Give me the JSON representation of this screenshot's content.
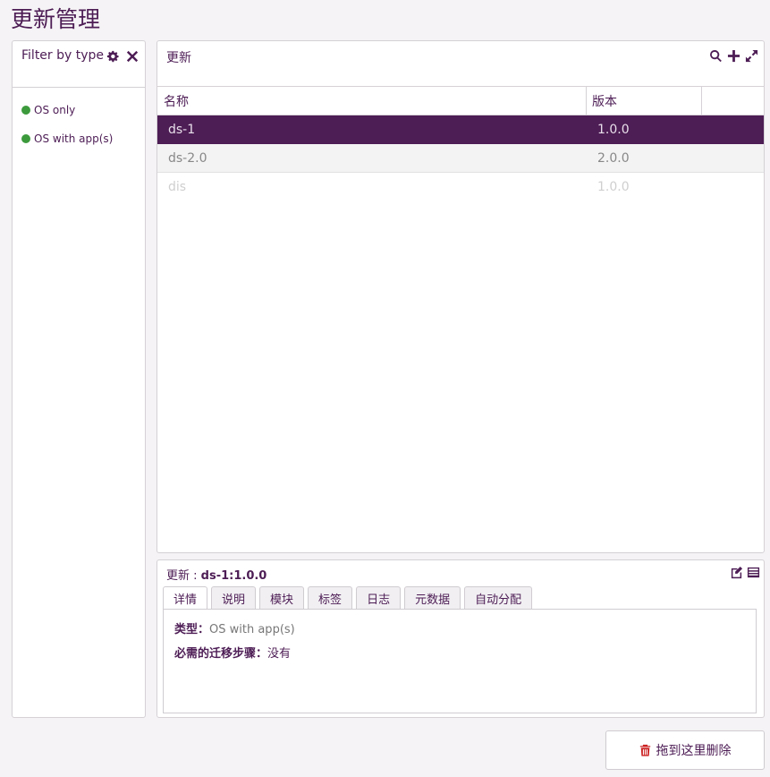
{
  "page": {
    "title": "更新管理"
  },
  "filter": {
    "title": "Filter by type",
    "items": [
      {
        "label": "OS only",
        "color": "#3c9a3c"
      },
      {
        "label": "OS with app(s)",
        "color": "#3c9a3c"
      }
    ]
  },
  "updates": {
    "title": "更新",
    "columns": {
      "name": "名称",
      "version": "版本"
    },
    "rows": [
      {
        "name": "ds-1",
        "version": "1.0.0",
        "state": "selected"
      },
      {
        "name": "ds-2.0",
        "version": "2.0.0",
        "state": "normal"
      },
      {
        "name": "dis",
        "version": "1.0.0",
        "state": "dim"
      }
    ]
  },
  "details": {
    "title_prefix": "更新 : ",
    "title_value": "ds-1:1.0.0",
    "tabs": [
      "详情",
      "说明",
      "模块",
      "标签",
      "日志",
      "元数据",
      "自动分配"
    ],
    "active_tab": "详情",
    "fields": {
      "type_label": "类型：",
      "type_value": "OS with app(s)",
      "migration_label": "必需的迁移步骤：",
      "migration_value": "没有"
    }
  },
  "delete_drop": {
    "label": "拖到这里删除"
  },
  "colors": {
    "accent": "#4d1d55",
    "status_green": "#3c9a3c",
    "delete_red": "#cc2222"
  }
}
